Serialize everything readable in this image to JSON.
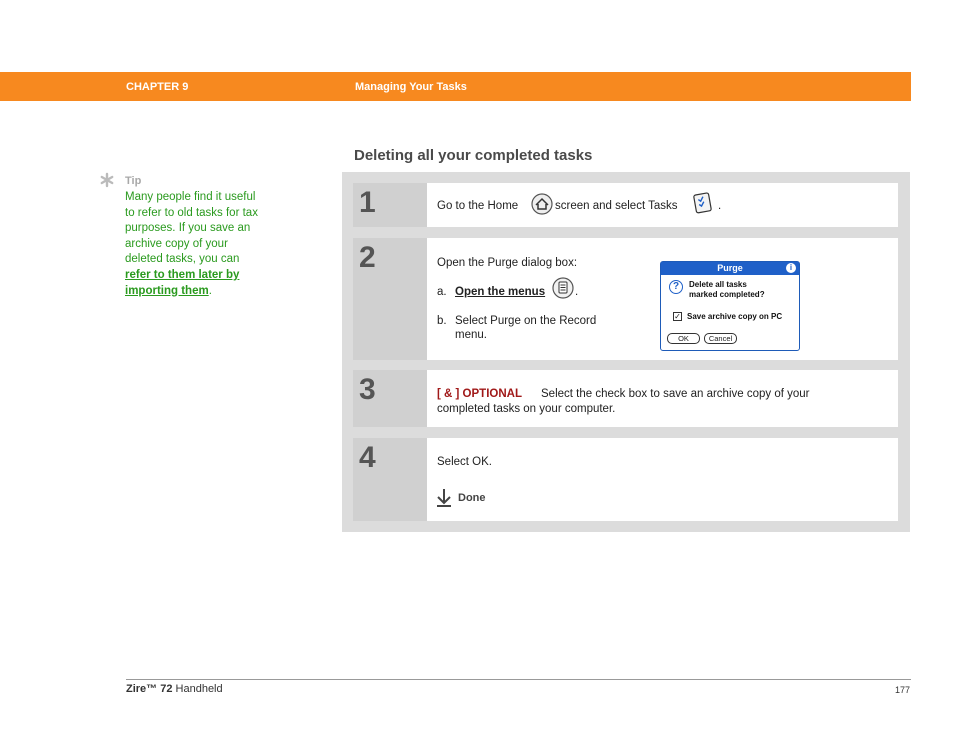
{
  "header": {
    "chapter": "CHAPTER 9",
    "title": "Managing Your Tasks",
    "color": "#f7891f"
  },
  "section": {
    "title": "Deleting all your completed tasks"
  },
  "tip": {
    "label": "Tip",
    "lines": [
      "Many people find it useful",
      "to refer to old tasks for tax",
      "purposes. If you save an",
      "archive copy of your",
      "deleted tasks, you can"
    ],
    "link_line1": "refer to them later by",
    "link_line2": "importing them",
    "period": "."
  },
  "steps": [
    {
      "number": "1",
      "text_before": "Go to the Home",
      "text_middle": "screen and select Tasks",
      "text_after": ".",
      "icons": [
        "home-icon",
        "tasks-icon"
      ]
    },
    {
      "number": "2",
      "intro": "Open the Purge dialog box:",
      "a_marker": "a.",
      "a_link": "Open the menus",
      "a_after": ".",
      "b_marker": "b.",
      "b_line1": "Select Purge on the Record",
      "b_line2": "menu.",
      "dialog": {
        "title": "Purge",
        "message_line1": "Delete all tasks",
        "message_line2": "marked completed?",
        "checkbox_label": "Save archive copy on PC",
        "ok": "OK",
        "cancel": "Cancel"
      }
    },
    {
      "number": "3",
      "optional_tag": "[ & ]  OPTIONAL",
      "line1": "Select the check box to save an archive copy of your",
      "line2": "completed tasks on your computer."
    },
    {
      "number": "4",
      "text": "Select OK.",
      "done": "Done"
    }
  ],
  "footer": {
    "product_bold": "Zire™ 72",
    "product_rest": " Handheld",
    "page": "177"
  }
}
